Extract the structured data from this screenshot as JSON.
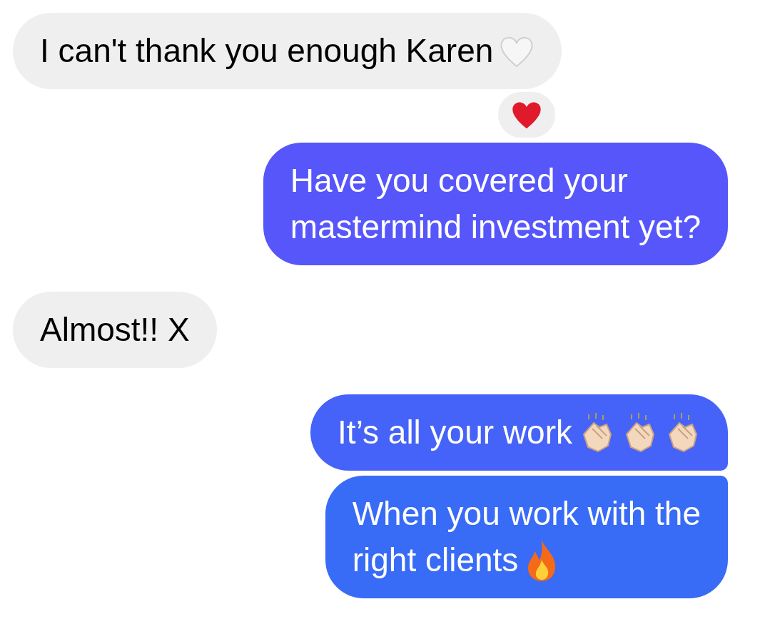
{
  "messages": [
    {
      "outgoing": false,
      "lines": [
        "I can't thank you enough Karen"
      ],
      "emoji": [
        {
          "kind": "white-heart"
        }
      ],
      "reaction": {
        "kind": "red-heart"
      },
      "joined_below": false,
      "joined_above": false
    },
    {
      "outgoing": true,
      "lines": [
        "Have you covered your",
        "mastermind investment yet?"
      ],
      "joined_below": false,
      "joined_above": false,
      "color": "#5656fb"
    },
    {
      "outgoing": false,
      "lines": [
        "Almost!! X"
      ],
      "joined_below": false,
      "joined_above": false
    },
    {
      "outgoing": true,
      "lines": [
        "It’s all your work"
      ],
      "emoji": [
        {
          "kind": "clap"
        },
        {
          "kind": "clap"
        },
        {
          "kind": "clap"
        }
      ],
      "joined_below": true,
      "joined_above": false,
      "color": "#4563f8"
    },
    {
      "outgoing": true,
      "lines": [
        "When you work with the",
        "right clients"
      ],
      "emoji": [
        {
          "kind": "fire"
        }
      ],
      "joined_below": false,
      "joined_above": true,
      "color": "#386bf6"
    }
  ]
}
